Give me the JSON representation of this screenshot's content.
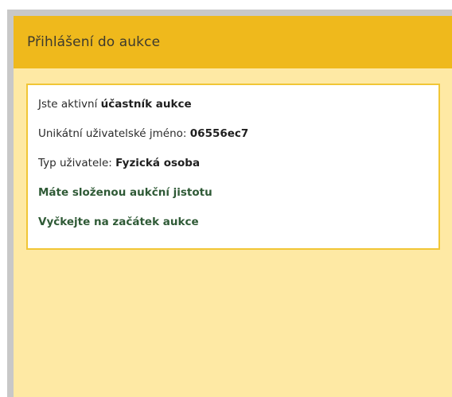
{
  "panel": {
    "title": "Přihlášení do aukce"
  },
  "info": {
    "line1_prefix": "Jste aktivní",
    "line1_value": "účastník aukce",
    "line2_prefix": "Unikátní uživatelské jméno:",
    "line2_value": "06556ec7",
    "line3_prefix": "Typ uživatele:",
    "line3_value": "Fyzická osoba",
    "line4": "Máte složenou aukční jistotu",
    "line5": "Vyčkejte na začátek aukce"
  },
  "colors": {
    "header_bg": "#efb91c",
    "panel_bg": "#fee9a4",
    "box_border": "#f1c636",
    "status_green": "#2f5a36"
  }
}
